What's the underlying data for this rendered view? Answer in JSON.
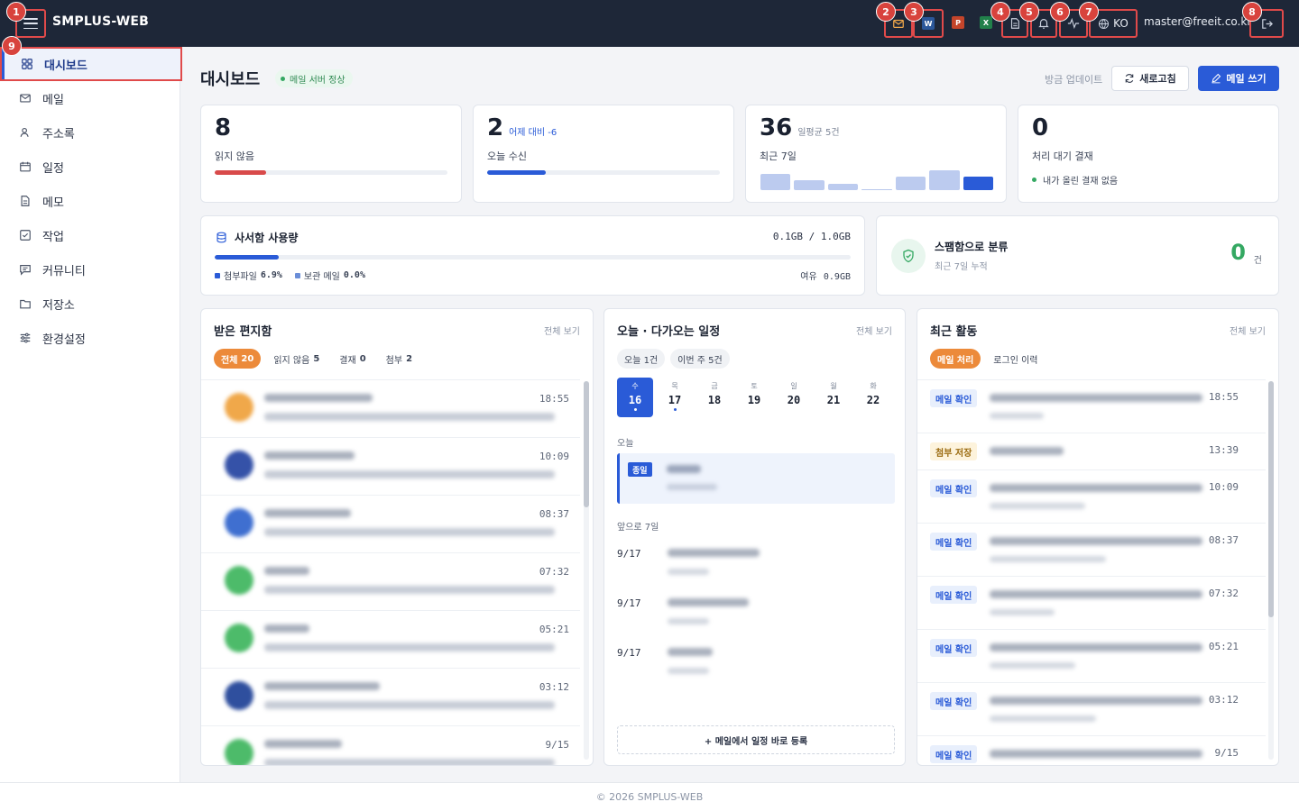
{
  "app": {
    "title": "SMPLUS-WEB",
    "user_email": "master@freeit.co.kr",
    "language": "KO"
  },
  "annotations": [
    "1",
    "2",
    "3",
    "4",
    "5",
    "6",
    "7",
    "8",
    "9"
  ],
  "sidebar": {
    "items": [
      {
        "label": "대시보드",
        "icon": "dashboard-icon",
        "active": true
      },
      {
        "label": "메일",
        "icon": "mail-icon"
      },
      {
        "label": "주소록",
        "icon": "contacts-icon"
      },
      {
        "label": "일정",
        "icon": "calendar-icon"
      },
      {
        "label": "메모",
        "icon": "memo-icon"
      },
      {
        "label": "작업",
        "icon": "task-icon"
      },
      {
        "label": "커뮤니티",
        "icon": "community-icon"
      },
      {
        "label": "저장소",
        "icon": "folder-icon"
      },
      {
        "label": "환경설정",
        "icon": "settings-icon"
      }
    ]
  },
  "header": {
    "title": "대시보드",
    "server_status": "메일 서버 정상",
    "updated": "방금 업데이트",
    "refresh_label": "새로고침",
    "compose_label": "메일 쓰기"
  },
  "stats": [
    {
      "value": "8",
      "sub": "",
      "label": "읽지 않음",
      "progress": 0.22,
      "color": "#d84a4a"
    },
    {
      "value": "2",
      "sub": "어제 대비 -6",
      "label": "오늘 수신",
      "progress": 0.25,
      "color": "#2a5bd7"
    },
    {
      "value": "36",
      "sub": "일평균 5건",
      "label": "최근 7일",
      "bars": [
        5,
        3,
        2,
        0,
        4,
        6,
        4
      ]
    },
    {
      "value": "0",
      "sub": "",
      "label": "처리 대기 결재",
      "note": "내가 올린 결재 없음"
    }
  ],
  "storage": {
    "title": "사서함 사용량",
    "usage": "0.1GB / 1.0GB",
    "progress": 0.1,
    "attach_label": "첨부파일",
    "attach_value": "6.9%",
    "archive_label": "보관 메일",
    "archive_value": "0.0%",
    "free_label": "여유",
    "free_value": "0.9GB"
  },
  "spam": {
    "title": "스팸함으로 분류",
    "subtitle": "최근 7일 누적",
    "count": "0",
    "unit": "건"
  },
  "inbox": {
    "title": "받은 편지함",
    "see_all": "전체 보기",
    "tabs": [
      {
        "label": "전체",
        "count": "20",
        "active": true
      },
      {
        "label": "읽지 않음",
        "count": "5"
      },
      {
        "label": "결재",
        "count": "0"
      },
      {
        "label": "첨부",
        "count": "2"
      }
    ],
    "rows": [
      {
        "time": "18:55",
        "avatar": "#f0a84a"
      },
      {
        "time": "10:09",
        "avatar": "#3552a8"
      },
      {
        "time": "08:37",
        "avatar": "#3f6fd0"
      },
      {
        "time": "07:32",
        "avatar": "#4dbb6a"
      },
      {
        "time": "05:21",
        "avatar": "#4dbb6a"
      },
      {
        "time": "03:12",
        "avatar": "#2f4f9e"
      },
      {
        "time": "9/15",
        "avatar": "#4dbb6a"
      }
    ]
  },
  "schedule": {
    "title": "오늘 · 다가오는 일정",
    "see_all": "전체 보기",
    "pills": [
      "오늘 1건",
      "이번 주 5건"
    ],
    "days": [
      {
        "name": "수",
        "date": "16",
        "selected": true,
        "dot": true
      },
      {
        "name": "목",
        "date": "17",
        "dot": true
      },
      {
        "name": "금",
        "date": "18"
      },
      {
        "name": "토",
        "date": "19"
      },
      {
        "name": "일",
        "date": "20"
      },
      {
        "name": "월",
        "date": "21"
      },
      {
        "name": "화",
        "date": "22"
      }
    ],
    "today_label": "오늘",
    "allday_tag": "종일",
    "upcoming_label": "앞으로 7일",
    "upcoming": [
      {
        "date": "9/17"
      },
      {
        "date": "9/17"
      },
      {
        "date": "9/17"
      }
    ],
    "add_label": "+ 메일에서 일정 바로 등록"
  },
  "activity": {
    "title": "최근 활동",
    "see_all": "전체 보기",
    "tabs": [
      {
        "label": "메일 처리",
        "active": true
      },
      {
        "label": "로그인 이력"
      }
    ],
    "rows": [
      {
        "tag": "메일 확인",
        "time": "18:55",
        "kind": "blue"
      },
      {
        "tag": "첨부 저장",
        "time": "13:39",
        "kind": "yellow"
      },
      {
        "tag": "메일 확인",
        "time": "10:09",
        "kind": "blue"
      },
      {
        "tag": "메일 확인",
        "time": "08:37",
        "kind": "blue"
      },
      {
        "tag": "메일 확인",
        "time": "07:32",
        "kind": "blue"
      },
      {
        "tag": "메일 확인",
        "time": "05:21",
        "kind": "blue"
      },
      {
        "tag": "메일 확인",
        "time": "03:12",
        "kind": "blue"
      },
      {
        "tag": "메일 확인",
        "time": "9/15",
        "kind": "blue"
      }
    ]
  },
  "footer": {
    "text": "© 2026 SMPLUS-WEB"
  },
  "colors": {
    "topbar": "#1e2738",
    "accent": "#2a5bd7",
    "orange": "#ec8a3a",
    "success": "#34a862",
    "annotation": "#d8433d"
  }
}
